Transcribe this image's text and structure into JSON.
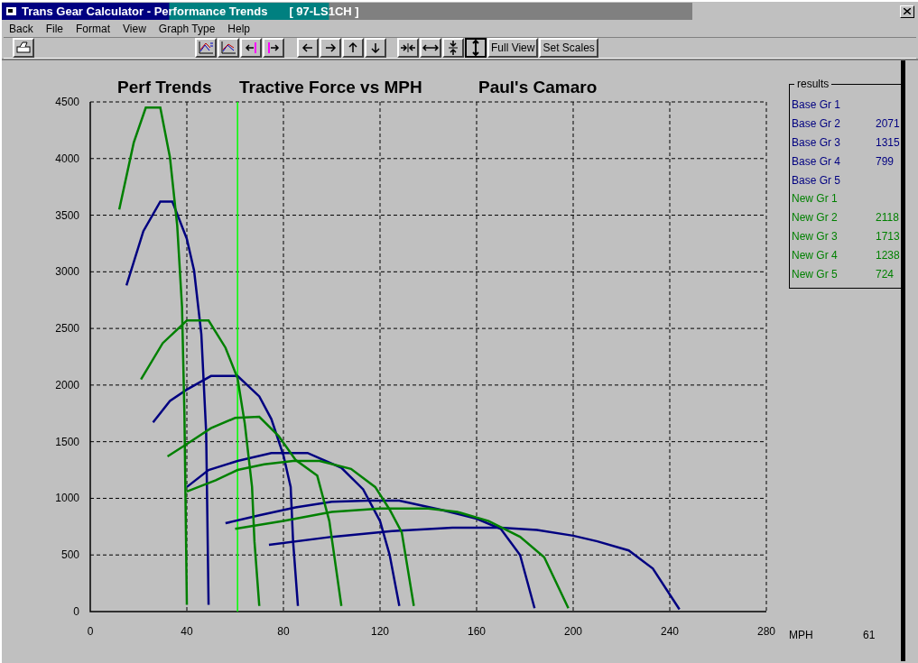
{
  "window": {
    "title": "Trans Gear Calculator - Performance Trends",
    "file_tag": "[ 97-LS1CH ]"
  },
  "menu": [
    "Back",
    "File",
    "Format",
    "View",
    "Graph Type",
    "Help"
  ],
  "toolbar": [
    [
      {
        "kind": "print",
        "pressed": false
      }
    ],
    [
      {
        "kind": "chart-a",
        "pressed": false
      },
      {
        "kind": "chart-b",
        "pressed": false
      },
      {
        "kind": "cursor-left",
        "pressed": false
      },
      {
        "kind": "cursor-right",
        "pressed": false
      }
    ],
    [
      {
        "kind": "pan-left",
        "pressed": false
      },
      {
        "kind": "pan-right",
        "pressed": false
      },
      {
        "kind": "pan-up",
        "pressed": false
      },
      {
        "kind": "pan-down",
        "pressed": false
      }
    ],
    [
      {
        "kind": "squeeze-h",
        "pressed": false
      },
      {
        "kind": "stretch-h",
        "pressed": false
      },
      {
        "kind": "squeeze-v",
        "pressed": false
      },
      {
        "kind": "stretch-v",
        "pressed": true
      },
      {
        "kind": "text",
        "label": "Full View",
        "pressed": false
      },
      {
        "kind": "text",
        "label": "Set Scales",
        "pressed": false
      }
    ]
  ],
  "graph_header": {
    "program": "Perf Trends",
    "vehicle": "Paul's Camaro"
  },
  "chart_data": {
    "type": "line",
    "title": "Tractive Force vs MPH",
    "xlim": [
      0,
      280
    ],
    "ylim": [
      0,
      4500
    ],
    "xticks": [
      0,
      40,
      80,
      120,
      160,
      200,
      240,
      280
    ],
    "yticks": [
      0,
      500,
      1000,
      1500,
      2000,
      2500,
      3000,
      3500,
      4000,
      4500
    ],
    "grid": true,
    "ref_lines": [
      {
        "axis": "x",
        "value": 61
      }
    ],
    "series": [
      {
        "color": "#000080",
        "x": [
          15,
          22,
          29,
          34,
          40,
          43,
          46,
          48,
          49
        ],
        "values": [
          2880,
          3360,
          3620,
          3620,
          3290,
          3010,
          2450,
          1580,
          60
        ]
      },
      {
        "color": "#000080",
        "x": [
          26,
          33,
          40,
          50,
          61,
          70,
          75,
          80,
          83,
          84,
          86
        ],
        "values": [
          1670,
          1860,
          1960,
          2080,
          2080,
          1900,
          1700,
          1380,
          1100,
          620,
          50
        ]
      },
      {
        "color": "#000080",
        "x": [
          40,
          49,
          61,
          75,
          90,
          104,
          113,
          120,
          124,
          128
        ],
        "values": [
          1100,
          1250,
          1330,
          1400,
          1400,
          1270,
          1080,
          800,
          500,
          50
        ]
      },
      {
        "color": "#000080",
        "x": [
          56,
          70,
          85,
          100,
          115,
          128,
          145,
          160,
          170,
          178,
          184
        ],
        "values": [
          780,
          850,
          920,
          970,
          980,
          980,
          900,
          820,
          730,
          500,
          30
        ]
      },
      {
        "color": "#000080",
        "x": [
          74,
          100,
          125,
          150,
          170,
          185,
          200,
          210,
          223,
          233,
          244
        ],
        "values": [
          590,
          660,
          710,
          740,
          740,
          720,
          670,
          620,
          540,
          380,
          20
        ]
      },
      {
        "color": "#008000",
        "x": [
          12,
          18,
          23,
          29,
          33,
          36,
          38,
          39,
          40
        ],
        "values": [
          3550,
          4140,
          4450,
          4450,
          4010,
          3410,
          2690,
          1740,
          60
        ]
      },
      {
        "color": "#008000",
        "x": [
          21,
          30,
          40,
          49,
          56,
          61,
          64,
          67,
          68,
          70
        ],
        "values": [
          2050,
          2370,
          2570,
          2570,
          2330,
          2060,
          1660,
          1100,
          620,
          50
        ]
      },
      {
        "color": "#008000",
        "x": [
          32,
          40,
          50,
          60,
          70,
          78,
          85,
          94,
          99,
          104
        ],
        "values": [
          1370,
          1480,
          1620,
          1710,
          1720,
          1550,
          1340,
          1200,
          800,
          50
        ]
      },
      {
        "color": "#008000",
        "x": [
          40,
          52,
          61,
          72,
          84,
          95,
          108,
          118,
          124,
          129,
          134
        ],
        "values": [
          1060,
          1160,
          1250,
          1300,
          1330,
          1330,
          1260,
          1100,
          900,
          700,
          50
        ]
      },
      {
        "color": "#008000",
        "x": [
          60,
          80,
          100,
          120,
          140,
          152,
          165,
          178,
          188,
          198
        ],
        "values": [
          730,
          800,
          880,
          910,
          910,
          880,
          800,
          660,
          480,
          30
        ]
      }
    ]
  },
  "results": {
    "title": "results",
    "rows": [
      {
        "name": "Base Gr 1",
        "color": "#000080"
      },
      {
        "name": "Base Gr 2",
        "value": "2071",
        "color": "#000080"
      },
      {
        "name": "Base Gr 3",
        "value": "1315",
        "color": "#000080"
      },
      {
        "name": "Base Gr 4",
        "value": "799",
        "color": "#000080"
      },
      {
        "name": "Base Gr 5",
        "color": "#000080"
      },
      {
        "name": "New Gr 1",
        "color": "#008000"
      },
      {
        "name": "New Gr 2",
        "value": "2118",
        "color": "#008000"
      },
      {
        "name": "New Gr 3",
        "value": "1713",
        "color": "#008000"
      },
      {
        "name": "New Gr 4",
        "value": "1238",
        "color": "#008000"
      },
      {
        "name": "New Gr 5",
        "value": "724",
        "color": "#008000"
      }
    ]
  },
  "cursor": {
    "label": "MPH",
    "value": "61"
  }
}
